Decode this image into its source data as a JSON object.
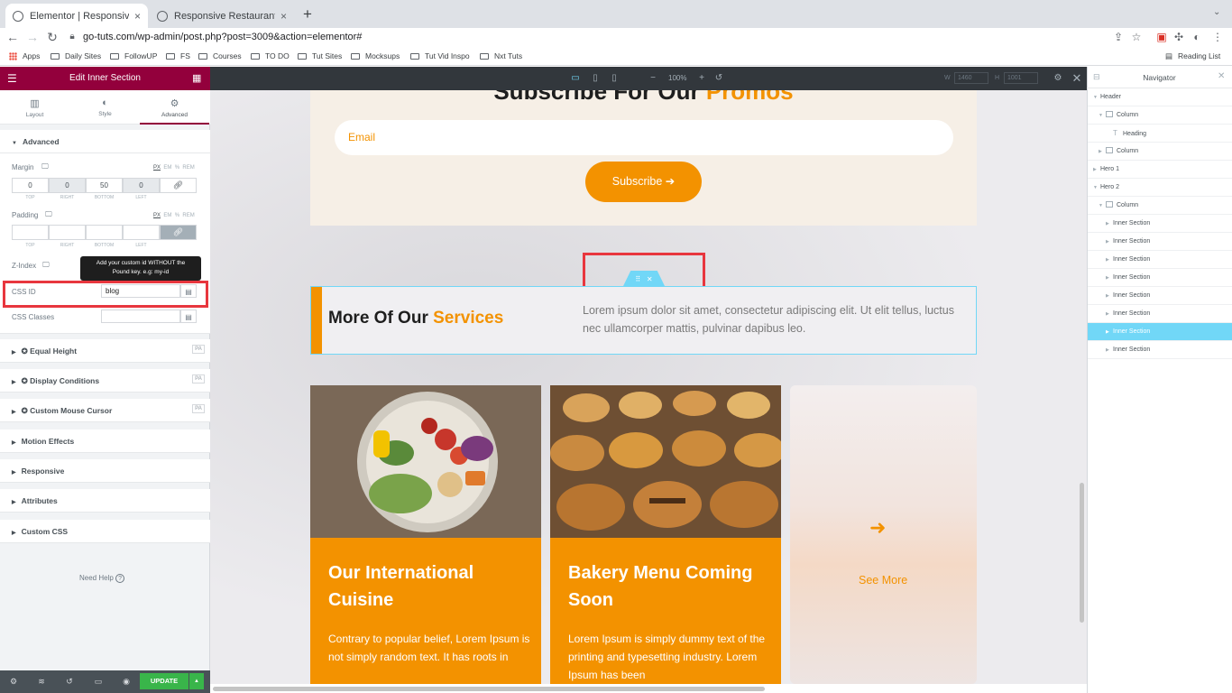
{
  "browser": {
    "tabs": [
      {
        "title": "Elementor | Responsive Restau",
        "active": true
      },
      {
        "title": "Responsive Restaurant Landin",
        "active": false
      }
    ],
    "new_tab": "+",
    "close": "×",
    "url": "go-tuts.com/wp-admin/post.php?post=3009&action=elementor#",
    "bookmarks": [
      "Apps",
      "Daily Sites",
      "FollowUP",
      "FS",
      "Courses",
      "TO DO",
      "Tut Sites",
      "Mocksups",
      "Tut Vid Inspo",
      "Nxt Tuts"
    ],
    "reading_list": "Reading List"
  },
  "panel": {
    "title": "Edit Inner Section",
    "tabs": [
      "Layout",
      "Style",
      "Advanced"
    ],
    "section_title": "Advanced",
    "margin": {
      "label": "Margin",
      "units": [
        "PX",
        "EM",
        "%",
        "REM"
      ],
      "values": [
        "0",
        "0",
        "50",
        "0"
      ],
      "labels": [
        "TOP",
        "RIGHT",
        "BOTTOM",
        "LEFT"
      ]
    },
    "padding": {
      "label": "Padding",
      "units": [
        "PX",
        "EM",
        "%",
        "REM"
      ],
      "labels": [
        "TOP",
        "RIGHT",
        "BOTTOM",
        "LEFT"
      ]
    },
    "zindex_label": "Z-Index",
    "tooltip_line1": "Add your custom id WITHOUT the",
    "tooltip_line2": "Pound key. e.g: my-id",
    "css_id_label": "CSS ID",
    "css_id_value": "blog",
    "css_classes_label": "CSS Classes",
    "sections": [
      "Equal Height",
      "Display Conditions",
      "Custom Mouse Cursor",
      "Motion Effects",
      "Responsive",
      "Attributes",
      "Custom CSS"
    ],
    "need_help": "Need Help",
    "update": "UPDATE"
  },
  "editor_bar": {
    "zoom": "100%",
    "w_label": "W",
    "w_value": "1460",
    "h_label": "H",
    "h_value": "1001"
  },
  "page": {
    "subscribe_title_dark": "Subscribe For Our",
    "subscribe_title_accent": "Promos",
    "email_placeholder": "Email",
    "subscribe_btn": "Subscribe ➔",
    "more_title_dark": "More Of Our",
    "more_title_accent": "Services",
    "lorem": "Lorem ipsum dolor sit amet, consectetur adipiscing elit. Ut elit tellus, luctus nec ullamcorper mattis, pulvinar dapibus leo.",
    "cards": [
      {
        "title": "Our International Cuisine",
        "text": "Contrary to popular belief, Lorem Ipsum is not simply random text. It has roots in"
      },
      {
        "title": "Bakery Menu Coming Soon",
        "text": "Lorem Ipsum is simply dummy text of the printing and typesetting industry. Lorem Ipsum has been"
      }
    ],
    "see_more": "See More"
  },
  "navigator": {
    "title": "Navigator",
    "items": [
      "Header",
      "Column",
      "Heading",
      "Column",
      "Hero 1",
      "Hero 2",
      "Column",
      "Inner Section",
      "Inner Section",
      "Inner Section",
      "Inner Section",
      "Inner Section",
      "Inner Section",
      "Inner Section",
      "Inner Section"
    ]
  },
  "colors": {
    "accent": "#f39200",
    "brand": "#93003c",
    "selection": "#71d7f7",
    "highlight_box": "#e8363e",
    "update": "#39b54a"
  }
}
